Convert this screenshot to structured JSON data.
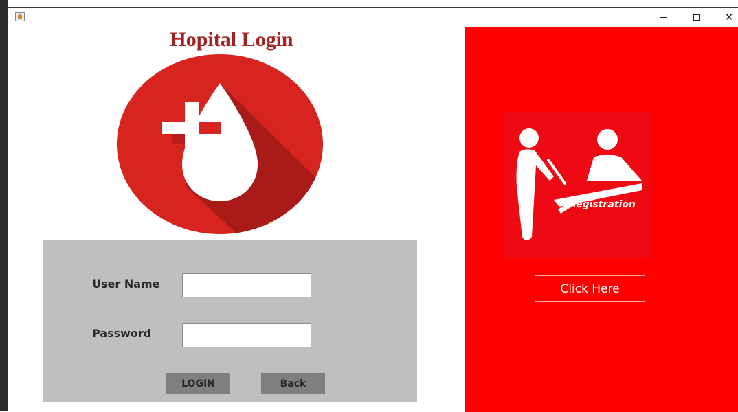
{
  "window": {
    "title": "",
    "minimize_glyph": "minimize-icon",
    "maximize_glyph": "maximize-icon",
    "close_label": "✕"
  },
  "header": {
    "title": "Hopital Login"
  },
  "logo": {
    "icon": "blood-drop-cross-icon",
    "circle_color": "#d8241f",
    "shadow_color": "#a81b18"
  },
  "login_form": {
    "username_label": "User Name",
    "username_value": "",
    "password_label": "Password",
    "password_value": "",
    "login_label": "LOGIN",
    "back_label": "Back",
    "panel_color": "#bfbfbf",
    "button_color": "#7f7f7f"
  },
  "registration": {
    "image_caption": "Registration",
    "image_icon": "registration-desk-icon",
    "click_label": "Click Here",
    "panel_color": "#ff0000"
  }
}
